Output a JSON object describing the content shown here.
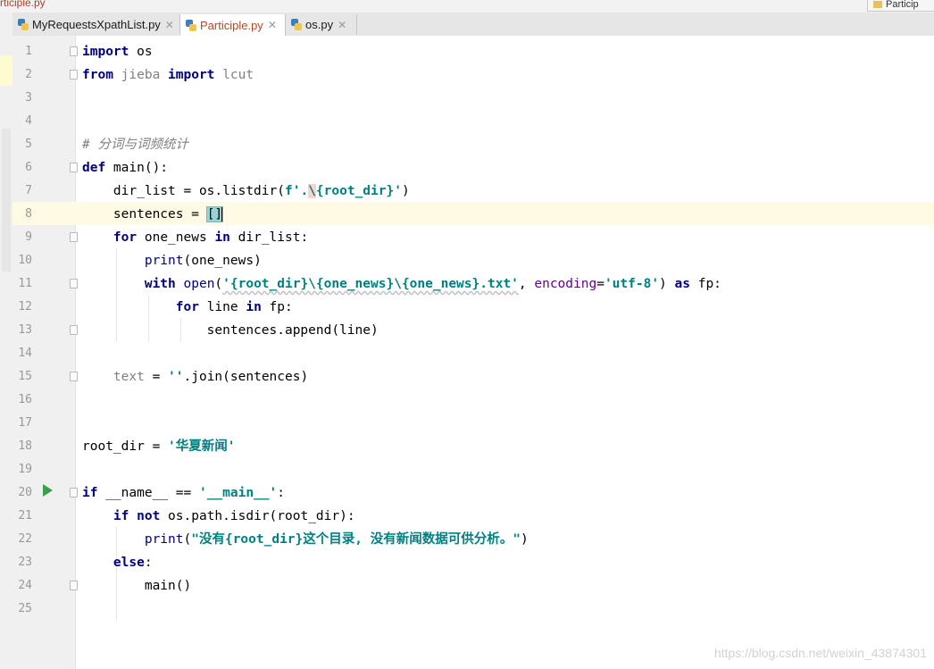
{
  "window": {
    "top_file": "rticiple.py",
    "top_right_tab": "Particip"
  },
  "tabs": [
    {
      "label": "MyRequestsXpathList.py",
      "active": false
    },
    {
      "label": "Participle.py",
      "active": true
    },
    {
      "label": "os.py",
      "active": false
    }
  ],
  "editor": {
    "line_numbers": [
      "1",
      "2",
      "3",
      "4",
      "5",
      "6",
      "7",
      "8",
      "9",
      "10",
      "11",
      "12",
      "13",
      "14",
      "15",
      "16",
      "17",
      "18",
      "19",
      "20",
      "21",
      "22",
      "23",
      "24",
      "25"
    ],
    "code": {
      "l1_kw": "import",
      "l1_rest": " os",
      "l2_kw1": "from",
      "l2_mod": " jieba ",
      "l2_kw2": "import",
      "l2_rest": " lcut",
      "l5_comment": "# 分词与词频统计",
      "l6_kw": "def",
      "l6_rest": " main():",
      "l7_a": "    dir_list = os.",
      "l7_fn": "listdir",
      "l7_b": "(",
      "l7_f": "f'",
      "l7_dot": ".",
      "l7_esc": "\\",
      "l7_c": "{root_dir}",
      "l7_q": "'",
      "l7_d": ")",
      "l8_a": "    sentences = ",
      "l8_brk": "[]",
      "l9_pre": "    ",
      "l9_kw1": "for",
      "l9_mid": " one_news ",
      "l9_kw2": "in",
      "l9_rest": " dir_list:",
      "l10_pre": "        ",
      "l10_fn": "print",
      "l10_rest": "(one_news)",
      "l11_pre": "        ",
      "l11_kw": "with",
      "l11_sp": " ",
      "l11_fn": "open",
      "l11_p": "(",
      "l11_str": "'{root_dir}\\{one_news}\\{one_news}.txt'",
      "l11_comma": ", ",
      "l11_param": "encoding",
      "l11_eq": "=",
      "l11_str2": "'utf-8'",
      "l11_close": ") ",
      "l11_as": "as",
      "l11_rest": " fp:",
      "l12_pre": "            ",
      "l12_kw1": "for",
      "l12_mid": " line ",
      "l12_kw2": "in",
      "l12_rest": " fp:",
      "l13": "                sentences.append(line)",
      "l15_pre": "    ",
      "l15_var": "text",
      "l15_mid": " = ",
      "l15_str": "''",
      "l15_rest": ".join(sentences)",
      "l18_a": "root_dir = ",
      "l18_str": "'华夏新闻'",
      "l20_kw": "if",
      "l20_mid": " __name__ == ",
      "l20_str": "'__main__'",
      "l20_end": ":",
      "l21_pre": "    ",
      "l21_kw1": "if",
      "l21_sp": " ",
      "l21_kw2": "not",
      "l21_rest": " os.path.isdir(root_dir):",
      "l22_pre": "        ",
      "l22_fn": "print",
      "l22_p": "(",
      "l22_str": "\"没有{root_dir}这个目录, 没有新闻数据可供分析。\"",
      "l22_end": ")",
      "l23_pre": "    ",
      "l23_kw": "else",
      "l23_end": ":",
      "l24": "        main()"
    }
  },
  "watermark": "https://blog.csdn.net/weixin_43874301"
}
